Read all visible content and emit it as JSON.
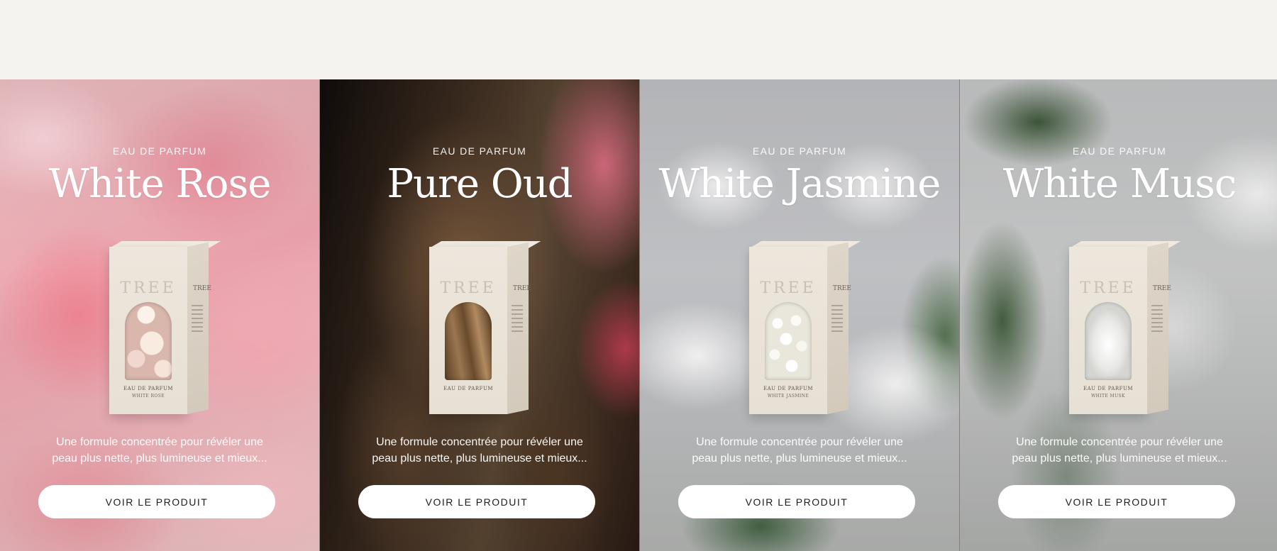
{
  "products": [
    {
      "eyebrow": "EAU DE PARFUM",
      "name": "White Rose",
      "box_brand": "TREE",
      "box_line1": "EAU DE PARFUM",
      "box_line2": "WHITE ROSE",
      "desc_line1": "Une formule concentrée pour révéler une",
      "desc_line2": "peau plus nette, plus lumineuse et mieux...",
      "cta": "VOIR LE PRODUIT"
    },
    {
      "eyebrow": "EAU DE PARFUM",
      "name": "Pure Oud",
      "box_brand": "TREE",
      "box_line1": "EAU DE PARFUM",
      "box_line2": "",
      "desc_line1": "Une formule concentrée pour révéler une",
      "desc_line2": "peau plus nette, plus lumineuse et mieux...",
      "cta": "VOIR LE PRODUIT"
    },
    {
      "eyebrow": "EAU DE PARFUM",
      "name": "White Jasmine",
      "box_brand": "TREE",
      "box_line1": "EAU DE PARFUM",
      "box_line2": "WHITE JASMINE",
      "desc_line1": "Une formule concentrée pour révéler une",
      "desc_line2": "peau plus nette, plus lumineuse et mieux...",
      "cta": "VOIR LE PRODUIT"
    },
    {
      "eyebrow": "EAU DE PARFUM",
      "name": "White Musc",
      "box_brand": "TREE",
      "box_line1": "EAU DE PARFUM",
      "box_line2": "WHITE MUSK",
      "desc_line1": "Une formule concentrée pour révéler une",
      "desc_line2": "peau plus nette, plus lumineuse et mieux...",
      "cta": "VOIR LE PRODUIT"
    }
  ],
  "colors": {
    "page_background": "#f4f3ef",
    "button_background": "#ffffff",
    "button_text": "#1c1c1c",
    "box_color": "#ece6dc"
  },
  "icons": []
}
